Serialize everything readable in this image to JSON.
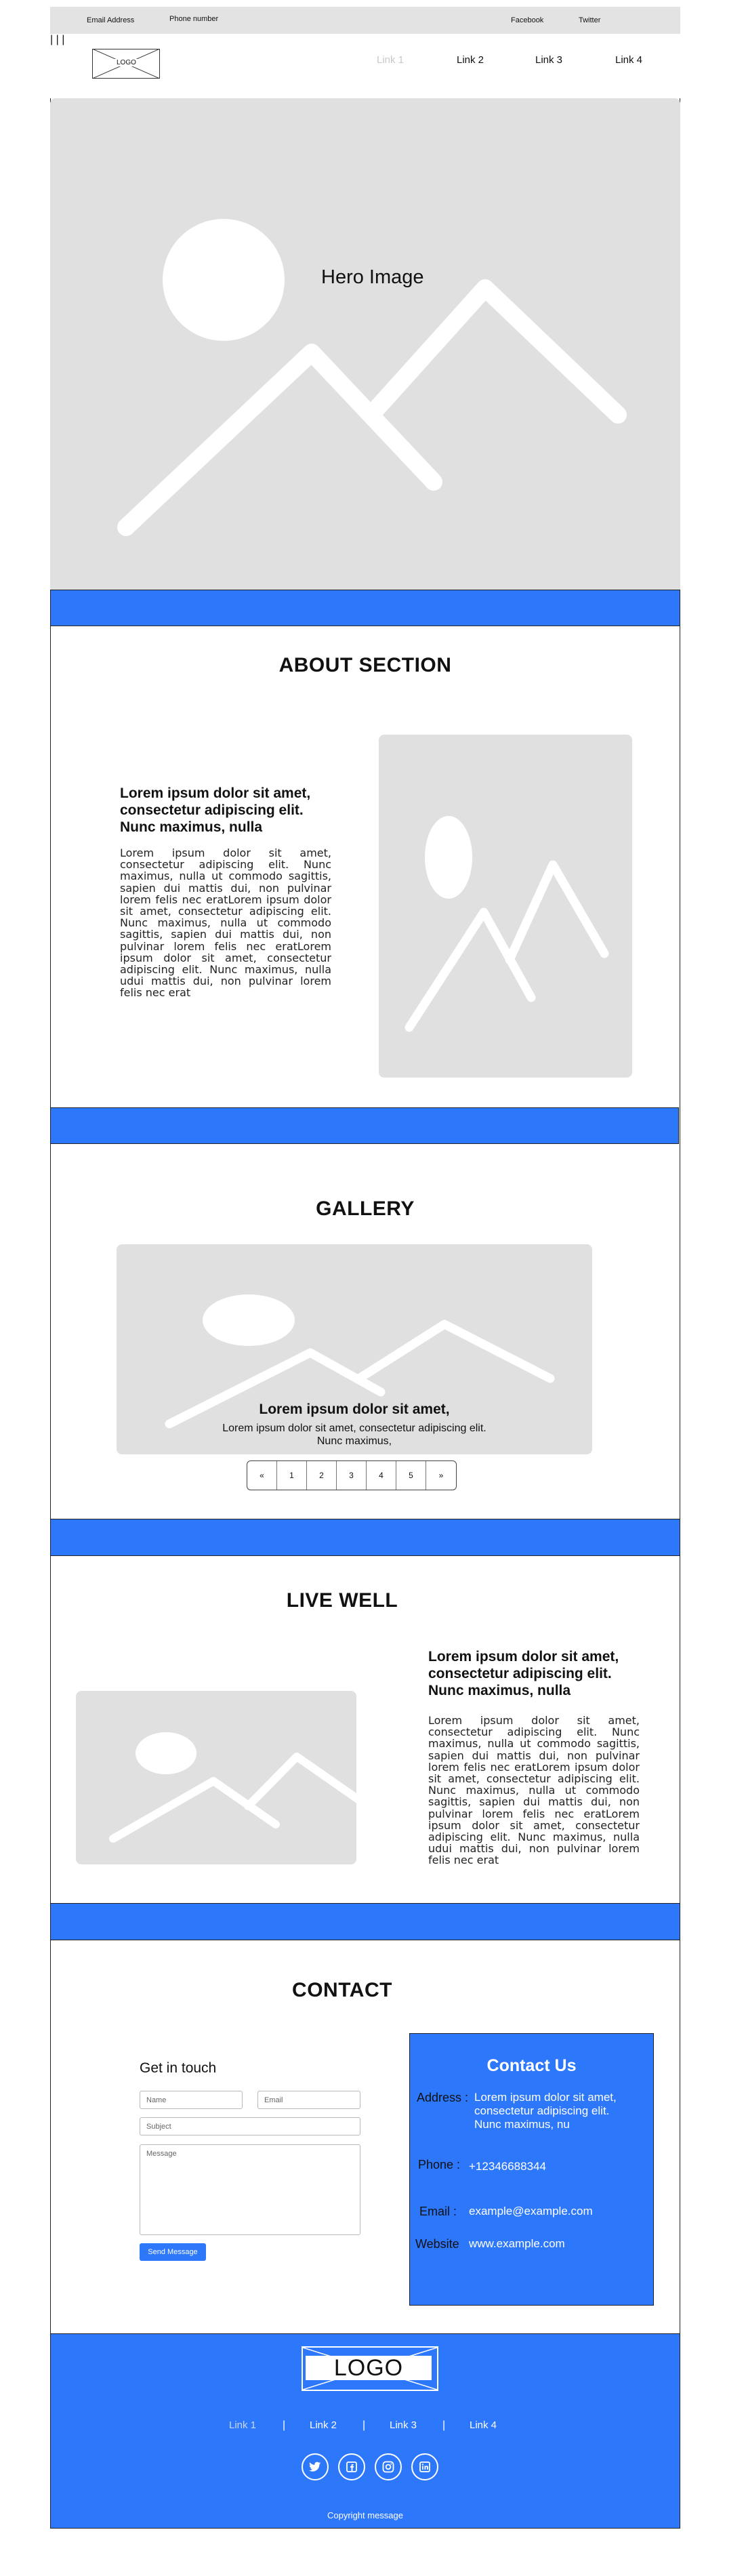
{
  "topbar": {
    "email": "Email Address",
    "phone": "Phone number",
    "facebook": "Facebook",
    "twitter": "Twitter"
  },
  "header": {
    "logo": "LOGO",
    "nav": [
      "Link 1",
      "Link 2",
      "Link 3",
      "Link 4"
    ]
  },
  "hero": {
    "label": "Hero Image"
  },
  "about": {
    "title": "ABOUT SECTION",
    "lead": "Lorem ipsum dolor sit amet, consectetur adipiscing elit. Nunc maximus, nulla",
    "body": "Lorem ipsum dolor sit amet, consectetur adipiscing elit. Nunc maximus, nulla ut commodo sagittis, sapien dui mattis dui, non pulvinar lorem felis nec eratLorem ipsum dolor sit amet, consectetur adipiscing elit. Nunc maximus, nulla ut commodo sagittis, sapien dui mattis dui, non pulvinar lorem felis nec eratLorem ipsum dolor sit amet, consectetur adipiscing elit. Nunc maximus, nulla udui mattis dui, non pulvinar lorem felis nec erat"
  },
  "gallery": {
    "title": "GALLERY",
    "caption_title": "Lorem ipsum dolor sit amet,",
    "caption_text": "Lorem ipsum dolor sit amet, consectetur adipiscing elit. Nunc maximus,",
    "pager": [
      "«",
      "1",
      "2",
      "3",
      "4",
      "5",
      "»"
    ]
  },
  "livewell": {
    "title": "LIVE WELL",
    "lead": "Lorem ipsum dolor sit amet, consectetur adipiscing elit. Nunc maximus, nulla",
    "body": "Lorem ipsum dolor sit amet, consectetur adipiscing elit. Nunc maximus, nulla ut commodo sagittis, sapien dui mattis dui, non pulvinar lorem felis nec eratLorem ipsum dolor sit amet, consectetur adipiscing elit. Nunc maximus, nulla ut commodo sagittis, sapien dui mattis dui, non pulvinar lorem felis nec eratLorem ipsum dolor sit amet, consectetur adipiscing elit. Nunc maximus, nulla udui mattis dui, non pulvinar lorem felis nec erat"
  },
  "contact": {
    "title": "CONTACT",
    "form_title": "Get in touch",
    "name_placeholder": "Name",
    "email_placeholder": "Email",
    "subject_placeholder": "Subject",
    "message_placeholder": "Message",
    "send_label": "Send Message",
    "card_title": "Contact Us",
    "address_label": "Address :",
    "address_value": "Lorem ipsum dolor sit amet, consectetur adipiscing elit. Nunc maximus, nu",
    "phone_label": "Phone :",
    "phone_value": "+12346688344",
    "email_label": "Email :",
    "email_value": "example@example.com",
    "website_label": "Website",
    "website_value": "www.example.com"
  },
  "footer": {
    "logo": "LOGO",
    "nav": [
      "Link 1",
      "Link 2",
      "Link 3",
      "Link 4"
    ],
    "social_icons": [
      "twitter-icon",
      "facebook-icon",
      "instagram-icon",
      "linkedin-icon"
    ],
    "copyright": "Copyright message"
  },
  "colors": {
    "accent_blue": "#2d77fb",
    "placeholder_gray": "#e0e0e0",
    "nav_active_gray": "#c9c9c9"
  }
}
